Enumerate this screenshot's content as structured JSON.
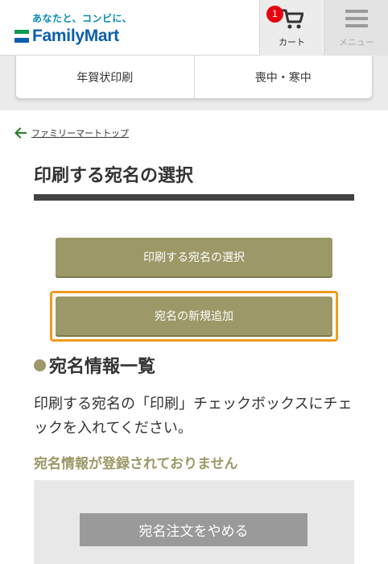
{
  "header": {
    "tagline": "あなたと、コンビに、",
    "brand": "FamilyMart",
    "cart": {
      "count": "1",
      "label": "カート"
    },
    "menu": {
      "label": "メニュー"
    }
  },
  "tabs": [
    {
      "label": "年賀状印刷"
    },
    {
      "label": "喪中・寒中"
    }
  ],
  "breadcrumb": {
    "link": "ファミリーマートトップ"
  },
  "page": {
    "title": "印刷する宛名の選択",
    "select_button": "印刷する宛名の選択",
    "add_button": "宛名の新規追加"
  },
  "section": {
    "heading": "宛名情報一覧",
    "instruction": "印刷する宛名の「印刷」チェックボックスにチェックを入れてください。",
    "empty_message": "宛名情報が登録されておりません",
    "cancel_button": "宛名注文をやめる"
  },
  "colors": {
    "brand_blue": "#0b5fae",
    "brand_green": "#0c9c4f",
    "olive": "#9c9867",
    "highlight_orange": "#f29a1e",
    "badge_red": "#e60012"
  }
}
